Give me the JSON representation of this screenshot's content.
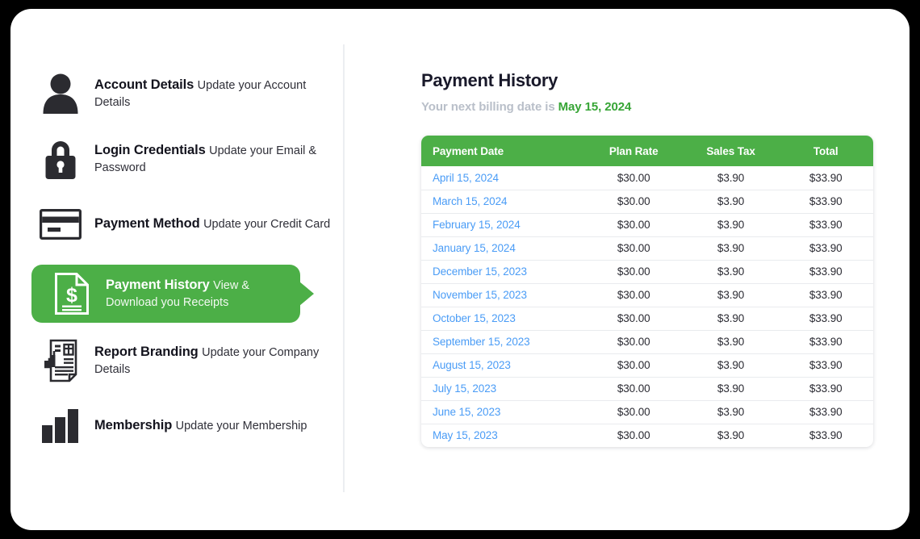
{
  "theme": {
    "accent_green": "#4caf47",
    "link_blue": "#4a9cf6",
    "billing_label_gray": "#b9bfc9",
    "billing_date_green": "#37a536",
    "title_dark": "#19192a",
    "page_background": "#000000"
  },
  "sidebar": {
    "items": [
      {
        "icon": "user-icon",
        "title": "Account Details",
        "subtitle": "Update your Account Details",
        "active": false
      },
      {
        "icon": "lock-icon",
        "title": "Login Credentials",
        "subtitle": "Update your Email & Password",
        "active": false
      },
      {
        "icon": "credit-card-icon",
        "title": "Payment Method",
        "subtitle": "Update your Credit Card",
        "active": false
      },
      {
        "icon": "invoice-dollar-icon",
        "title": "Payment History",
        "subtitle": "View & Download you Receipts",
        "active": true
      },
      {
        "icon": "report-document-icon",
        "title": "Report Branding",
        "subtitle": "Update your Company Details",
        "active": false
      },
      {
        "icon": "bar-chart-icon",
        "title": "Membership",
        "subtitle": "Update your Membership",
        "active": false
      }
    ]
  },
  "main": {
    "page_title": "Payment History",
    "billing_label": "Your next billing date is",
    "billing_date": "May 15, 2024"
  },
  "table": {
    "columns": [
      "Payment Date",
      "Plan Rate",
      "Sales Tax",
      "Total"
    ],
    "rows": [
      {
        "date": "April 15, 2024",
        "plan_rate": "$30.00",
        "sales_tax": "$3.90",
        "total": "$33.90"
      },
      {
        "date": "March 15, 2024",
        "plan_rate": "$30.00",
        "sales_tax": "$3.90",
        "total": "$33.90"
      },
      {
        "date": "February 15, 2024",
        "plan_rate": "$30.00",
        "sales_tax": "$3.90",
        "total": "$33.90"
      },
      {
        "date": "January 15, 2024",
        "plan_rate": "$30.00",
        "sales_tax": "$3.90",
        "total": "$33.90"
      },
      {
        "date": "December 15, 2023",
        "plan_rate": "$30.00",
        "sales_tax": "$3.90",
        "total": "$33.90"
      },
      {
        "date": "November 15, 2023",
        "plan_rate": "$30.00",
        "sales_tax": "$3.90",
        "total": "$33.90"
      },
      {
        "date": "October 15, 2023",
        "plan_rate": "$30.00",
        "sales_tax": "$3.90",
        "total": "$33.90"
      },
      {
        "date": "September 15, 2023",
        "plan_rate": "$30.00",
        "sales_tax": "$3.90",
        "total": "$33.90"
      },
      {
        "date": "August 15, 2023",
        "plan_rate": "$30.00",
        "sales_tax": "$3.90",
        "total": "$33.90"
      },
      {
        "date": "July 15, 2023",
        "plan_rate": "$30.00",
        "sales_tax": "$3.90",
        "total": "$33.90"
      },
      {
        "date": "June 15, 2023",
        "plan_rate": "$30.00",
        "sales_tax": "$3.90",
        "total": "$33.90"
      },
      {
        "date": "May 15, 2023",
        "plan_rate": "$30.00",
        "sales_tax": "$3.90",
        "total": "$33.90"
      }
    ]
  }
}
